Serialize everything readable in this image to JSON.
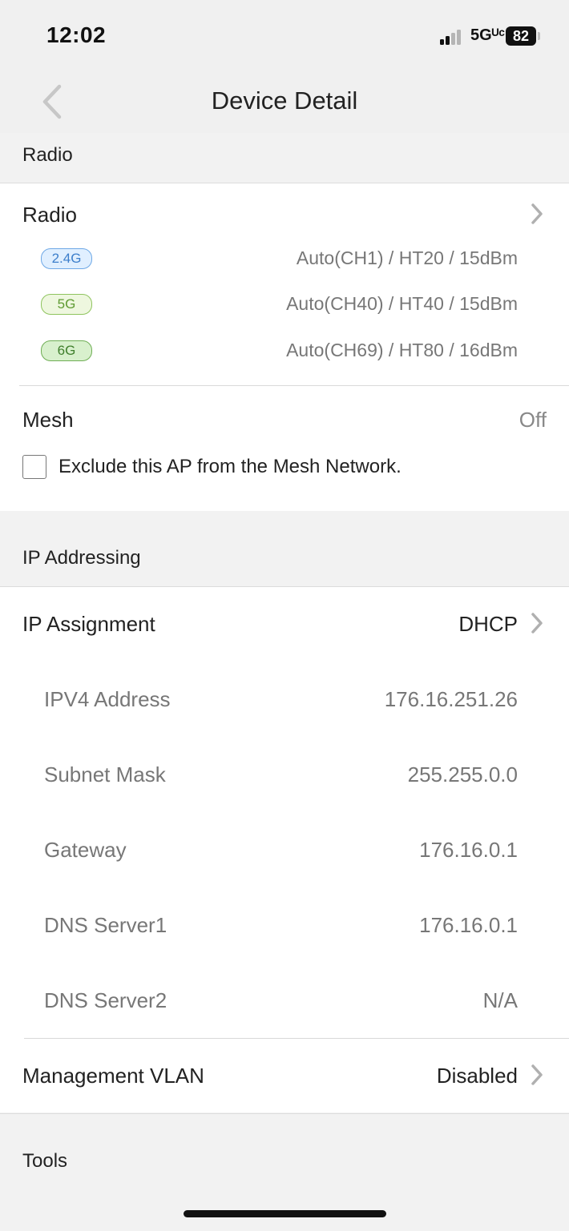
{
  "status_bar": {
    "time": "12:02",
    "network": "5Gᵁᶜ",
    "battery": "82"
  },
  "header": {
    "title": "Device Detail",
    "back_icon": "chevron-left-icon"
  },
  "radio_section": {
    "header": "Radio",
    "title": "Radio",
    "bands": [
      {
        "badge": "2.4G",
        "value": "Auto(CH1) / HT20 / 15dBm"
      },
      {
        "badge": "5G",
        "value": "Auto(CH40) / HT40 / 15dBm"
      },
      {
        "badge": "6G",
        "value": "Auto(CH69) / HT80 / 16dBm"
      }
    ],
    "mesh_label": "Mesh",
    "mesh_value": "Off",
    "exclude_label": "Exclude this AP from the Mesh Network.",
    "exclude_checked": false
  },
  "ip_section": {
    "header": "IP Addressing",
    "assignment_label": "IP Assignment",
    "assignment_value": "DHCP",
    "fields": [
      {
        "label": "IPV4 Address",
        "value": "176.16.251.26"
      },
      {
        "label": "Subnet Mask",
        "value": "255.255.0.0"
      },
      {
        "label": "Gateway",
        "value": "176.16.0.1"
      },
      {
        "label": "DNS Server1",
        "value": "176.16.0.1"
      },
      {
        "label": "DNS Server2",
        "value": "N/A"
      }
    ],
    "vlan_label": "Management VLAN",
    "vlan_value": "Disabled"
  },
  "tools_section": {
    "header": "Tools"
  },
  "colors": {
    "chevron": "#b0b0b0",
    "secondary_text": "#777777",
    "section_bg": "#f2f2f2"
  }
}
